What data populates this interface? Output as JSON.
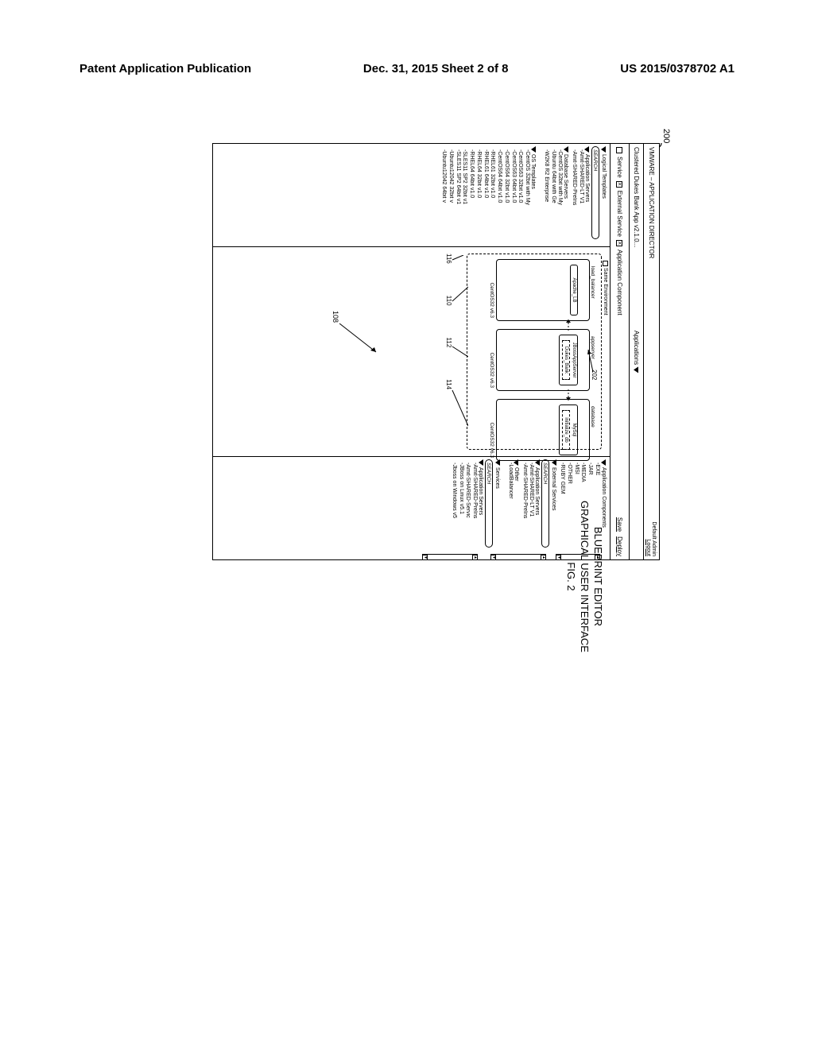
{
  "header": {
    "left": "Patent Application Publication",
    "center": "Dec. 31, 2015  Sheet 2 of 8",
    "right": "US 2015/0378702 A1"
  },
  "figure_ref": "200",
  "titlebar": {
    "left": "VMWARE – APPLICATION DIRECTOR",
    "right_top": "Default Admin",
    "right_bottom": "Logout"
  },
  "breadcrumb": {
    "app_name": "Clustered Dukes Bank App v2.1.0...",
    "apps_label": "Applications"
  },
  "legend": {
    "service": "Service",
    "external": "External Service",
    "component": "Application Component"
  },
  "actions": {
    "save": "Save",
    "deploy": "Deploy"
  },
  "left_panel": {
    "sec1": "Logical Templates",
    "search": "SEARCH",
    "app_servers": "Application Servers",
    "as_items": [
      "-Amit-SHARED-LT V1",
      "-Amit-SHARED-PreIns"
    ],
    "db_servers": "Database Servers",
    "db_items": [
      "-CentOS 32bit with My",
      "-Ubuntu 64bit with Ge",
      "-W2K8 R2 Enterprise"
    ],
    "os_tpl": "OS Templates",
    "os_items": [
      "-CentOS 32bit with My",
      "-CentOS63 32bit v1.0",
      "-CentOS63 64bit v1.0",
      "-CentOS64 32bit v1.0",
      "-CentOS64 64bit v1.0",
      "-RHEL61 32bit v1.0",
      "-RHEL61 64bit v1.0",
      "-RHEL64 32bit v1.0",
      "-RHEL64 64bit v1.0",
      "-SLES11 SP2 32bit v1",
      "-SLES11 SP2 64bit v1",
      "-Ubuntu12042 32bit v",
      "-Ubuntu12042 64bit v"
    ]
  },
  "right_panel": {
    "sec1": "Application Components",
    "ac_items": [
      "-EXE",
      "-JAR",
      "-MEDIA",
      "-MSI",
      "-OTHER",
      "-RUBY GEM"
    ],
    "ext_svc": "External Services",
    "search": "SEARCH",
    "app_servers": "Application Servers",
    "as_items": [
      "-Amit-SHARED-LT V1",
      "-Amit-SHARED-PreIns"
    ],
    "other": "Other",
    "other_items": [
      "-LoadBalancer"
    ],
    "services": "Services",
    "svc_search": "SEARCH",
    "svc_as": "Application Servers",
    "svc_items": [
      "-Amit-SHARED-PreIns",
      "-Amit-SHARED-Servic",
      "-JBoss on Linux v5.1",
      "-Jboss on Windows v5"
    ]
  },
  "canvas": {
    "same_env": "Same Environment",
    "vm1": {
      "label": "load_balancer",
      "svc": "Apache_LB",
      "os": "CentOS32 v6.3"
    },
    "vm2": {
      "label": "appserver",
      "svc": "JBossAppServer",
      "inner": "Dukes_Bank",
      "os": "CentOS32 v6.3"
    },
    "vm3": {
      "label": "database",
      "svc": "MySql",
      "inner": "initialize_db",
      "os": "CentOS32 v6.3"
    },
    "ref_202": "202"
  },
  "refs": {
    "r116": "116",
    "r110": "110",
    "r112": "112",
    "r114": "114",
    "r108": "108"
  },
  "caption": {
    "line1": "BLUEPRINT EDITOR",
    "line2": "GRAPHICAL USER INTERFACE",
    "line3": "FIG. 2"
  }
}
